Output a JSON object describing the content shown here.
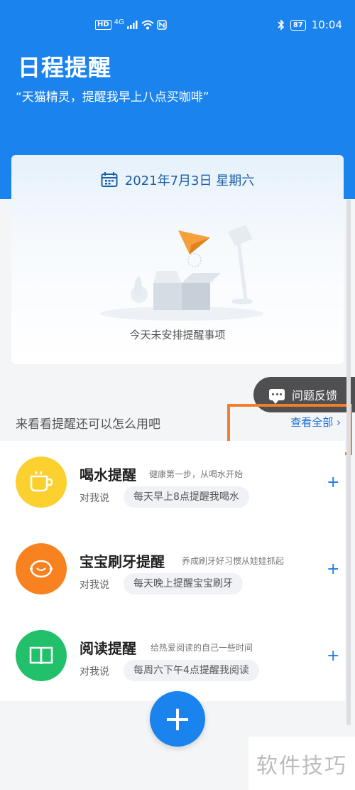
{
  "status_bar": {
    "hd": "HD",
    "network": "4G",
    "time": "10:04",
    "battery": "87",
    "bluetooth_icon": "bluetooth-icon"
  },
  "header": {
    "title": "日程提醒",
    "subtitle": "“天猫精灵，提醒我早上八点买咖啡”"
  },
  "date_card": {
    "date": "2021年7月3日 星期六",
    "empty_text": "今天未安排提醒事项",
    "calendar_icon": "calendar-icon"
  },
  "feedback": {
    "label": "问题反馈"
  },
  "section": {
    "title": "来看看提醒还可以怎么用吧",
    "view_all": "查看全部 ›"
  },
  "items": [
    {
      "title": "喝水提醒",
      "desc": "健康第一步，从喝水开始",
      "say": "对我说",
      "example": "每天早上8点提醒我喝水",
      "icon": "cup-icon",
      "color": "#fcd02f"
    },
    {
      "title": "宝宝刷牙提醒",
      "desc": "养成刷牙好习惯从娃娃抓起",
      "say": "对我说",
      "example": "每天晚上提醒宝宝刷牙",
      "icon": "lemon-icon",
      "color": "#f7821f"
    },
    {
      "title": "阅读提醒",
      "desc": "给热爱阅读的自己一些时间",
      "say": "对我说",
      "example": "每周六下午4点提醒我阅读",
      "icon": "book-icon",
      "color": "#22c06b"
    }
  ],
  "fab": {
    "label": "+"
  },
  "watermark": "软件技巧"
}
